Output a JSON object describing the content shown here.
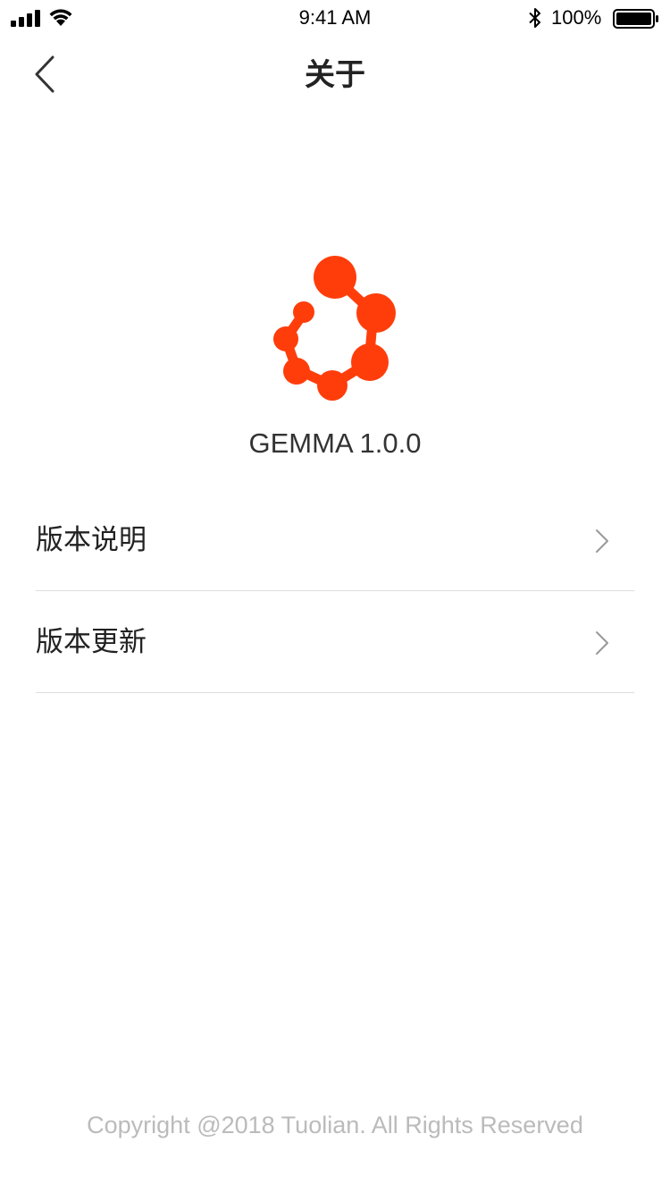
{
  "status_bar": {
    "time": "9:41 AM",
    "battery_percent": "100%",
    "icons": [
      "signal-icon",
      "wifi-icon",
      "bluetooth-icon",
      "battery-icon"
    ]
  },
  "nav": {
    "title": "关于",
    "back_icon": "chevron-left-icon"
  },
  "app": {
    "logo_icon": "gemma-logo-icon",
    "version_text": "GEMMA 1.0.0",
    "brand_color": "#FF3D0B"
  },
  "menu": {
    "items": [
      {
        "label": "版本说明",
        "icon": "chevron-right-icon"
      },
      {
        "label": "版本更新",
        "icon": "chevron-right-icon"
      }
    ]
  },
  "footer": {
    "copyright": "Copyright @2018 Tuolian. All Rights Reserved"
  }
}
